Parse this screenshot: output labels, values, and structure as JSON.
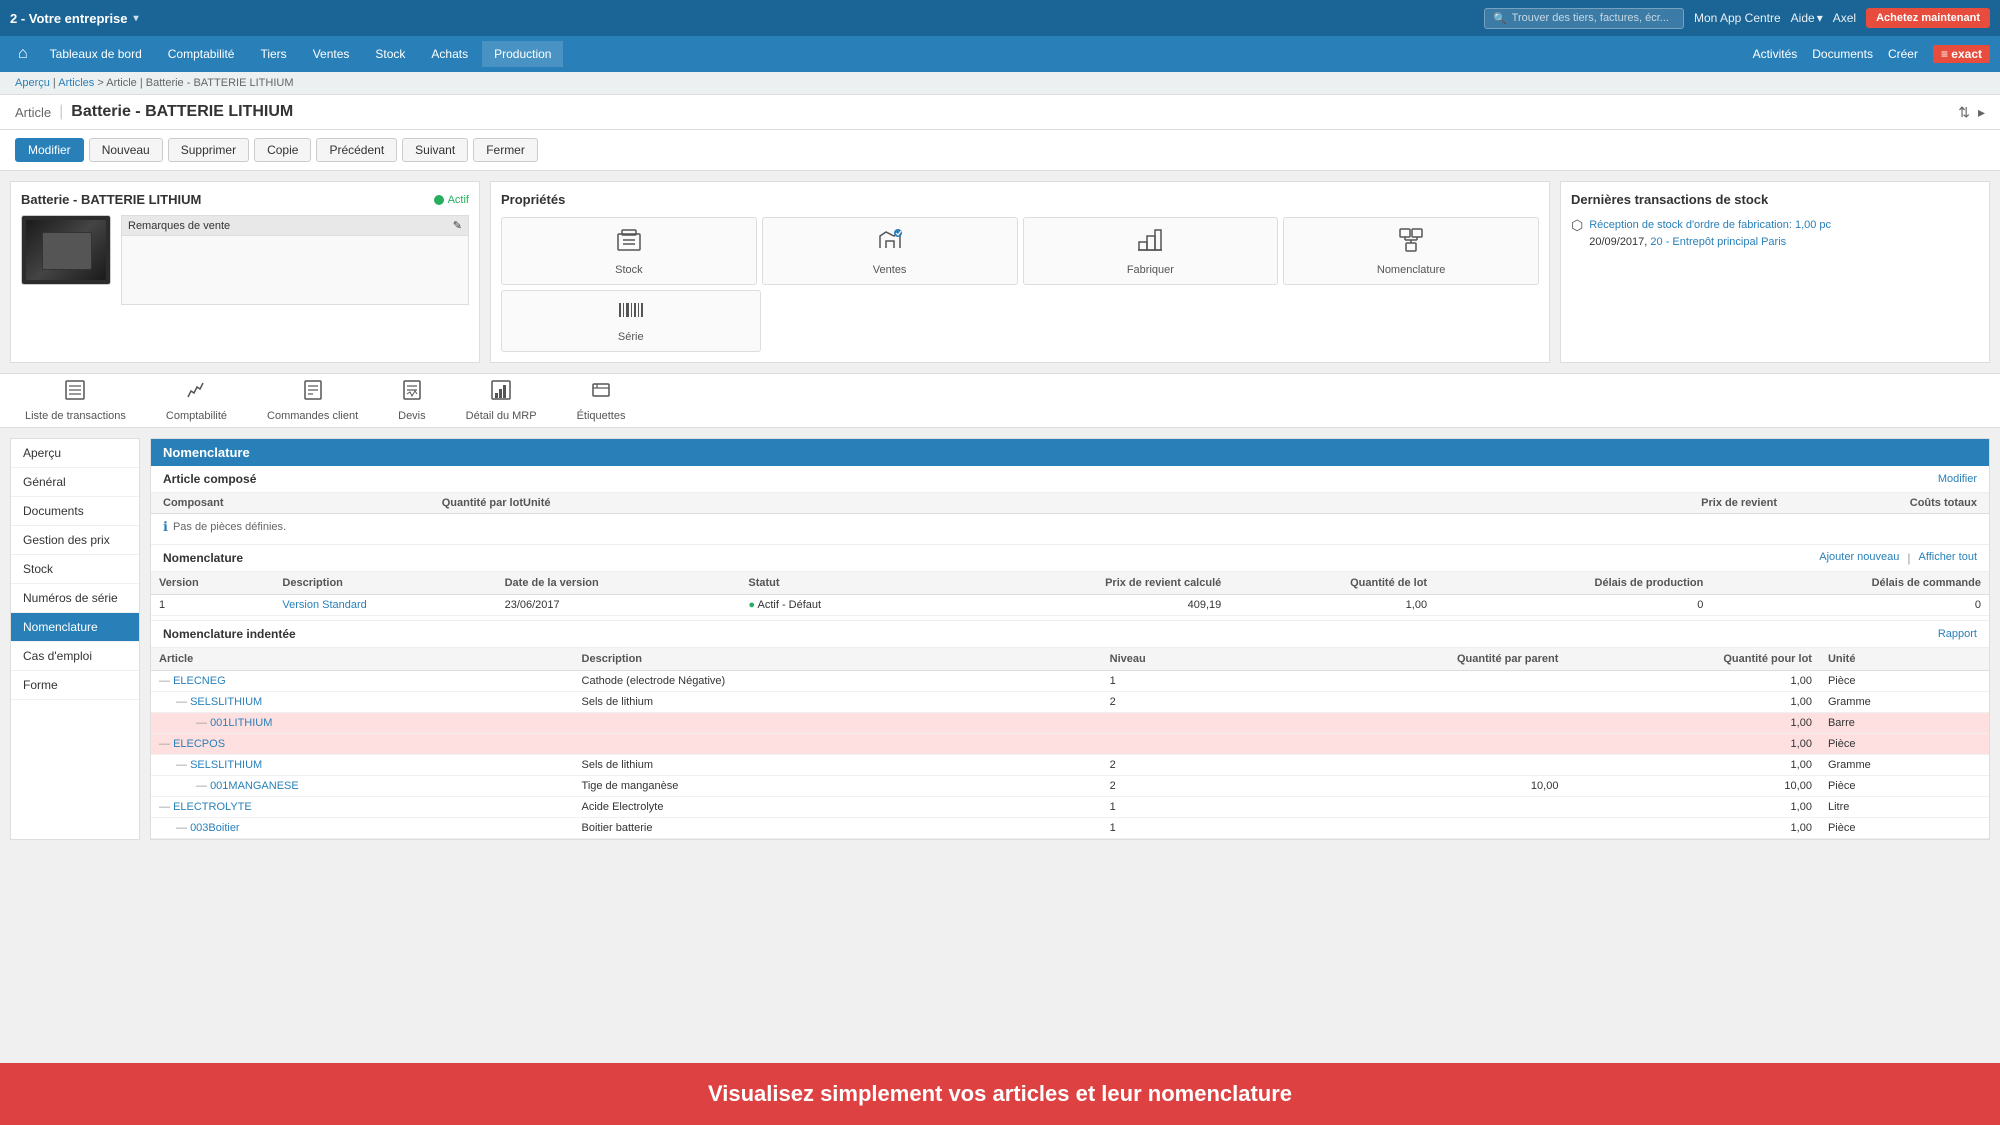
{
  "topbar": {
    "company": "2 - Votre entreprise",
    "search_placeholder": "Trouver des tiers, factures, écr...",
    "mon_app_centre": "Mon App Centre",
    "aide": "Aide",
    "user": "Axel",
    "achetez_label": "Achetez maintenant"
  },
  "navbar": {
    "home_icon": "⌂",
    "items": [
      "Tableaux de bord",
      "Comptabilité",
      "Tiers",
      "Ventes",
      "Stock",
      "Achats",
      "Production"
    ],
    "right_items": [
      "Activités",
      "Documents",
      "Créer"
    ],
    "exact_label": "≡ exact"
  },
  "breadcrumb": {
    "items": [
      "Aperçu",
      "Articles",
      "Article | Batterie - BATTERIE LITHIUM"
    ]
  },
  "page_header": {
    "label": "Article",
    "title": "Batterie - BATTERIE LITHIUM",
    "icon": "⇅"
  },
  "action_buttons": {
    "modifier": "Modifier",
    "nouveau": "Nouveau",
    "supprimer": "Supprimer",
    "copie": "Copie",
    "precedent": "Précédent",
    "suivant": "Suivant",
    "fermer": "Fermer"
  },
  "article": {
    "name": "Batterie - BATTERIE LITHIUM",
    "active_label": "Actif",
    "notes_label": "Remarques de vente",
    "edit_icon": "✎"
  },
  "proprietes": {
    "title": "Propriétés",
    "items": [
      {
        "icon": "📦",
        "label": "Stock"
      },
      {
        "icon": "🛒",
        "label": "Ventes"
      },
      {
        "icon": "🔧",
        "label": "Fabriquer"
      },
      {
        "icon": "📋",
        "label": "Nomenclature"
      },
      {
        "icon": "▦",
        "label": "Série"
      }
    ]
  },
  "transactions": {
    "title": "Dernières transactions de stock",
    "icon": "⬡",
    "text1": "Réception de stock d'ordre de fabrication:",
    "value1": "1,00 pc",
    "date1": "20/09/2017,",
    "link1": "20 - Entrepôt principal Paris"
  },
  "bottom_tabs": [
    {
      "icon": "☰",
      "label": "Liste de transactions"
    },
    {
      "icon": "∑",
      "label": "Comptabilité"
    },
    {
      "icon": "📋",
      "label": "Commandes client"
    },
    {
      "icon": "📄",
      "label": "Devis"
    },
    {
      "icon": "📊",
      "label": "Détail du MRP"
    },
    {
      "icon": "🏷",
      "label": "Étiquettes"
    }
  ],
  "sidebar": {
    "items": [
      {
        "label": "Aperçu",
        "active": false
      },
      {
        "label": "Général",
        "active": false
      },
      {
        "label": "Documents",
        "active": false
      },
      {
        "label": "Gestion des prix",
        "active": false
      },
      {
        "label": "Stock",
        "active": false
      },
      {
        "label": "Numéros de série",
        "active": false
      },
      {
        "label": "Nomenclature",
        "active": true
      },
      {
        "label": "Cas d'emploi",
        "active": false
      },
      {
        "label": "Forme",
        "active": false
      }
    ]
  },
  "nomenclature": {
    "section_title": "Nomenclature",
    "article_compose_title": "Article composé",
    "modifier_link": "Modifier",
    "table_headers": {
      "composant": "Composant",
      "qty": "Quantité par lot",
      "unite": "Unité",
      "prix": "Prix de revient",
      "cout": "Coûts totaux"
    },
    "no_pieces": "Pas de pièces définies.",
    "subsection2_title": "Nomenclature",
    "ajouter_link": "Ajouter nouveau",
    "afficher_link": "Afficher tout",
    "nom_headers": {
      "version": "Version",
      "description": "Description",
      "date": "Date de la version",
      "statut": "Statut",
      "prix_calcule": "Prix de revient calculé",
      "qty_lot": "Quantité de lot",
      "delais_prod": "Délais de production",
      "delais_cmd": "Délais de commande"
    },
    "nom_rows": [
      {
        "version": "1",
        "description": "Version Standard",
        "date": "23/06/2017",
        "statut_icon": "●",
        "statut": "Actif - Défaut",
        "prix": "409,19",
        "qty_lot": "1,00",
        "delais_prod": "0",
        "delais_cmd": "0"
      }
    ],
    "subsection3_title": "Nomenclature indentée",
    "rapport_link": "Rapport",
    "indent_headers": {
      "article": "Article",
      "description": "Description",
      "niveau": "Niveau",
      "qty_parent": "Quantité par parent",
      "qty_lot": "Quantité pour lot",
      "unite": "Unité"
    },
    "indent_rows": [
      {
        "indent": 0,
        "dash": "—",
        "code": "ELECNEG",
        "description": "Cathode (electrode Négative)",
        "niveau": "1",
        "qty_parent": "",
        "qty_lot": "1,00",
        "qty_lot2": "1,00",
        "unite": "Pièce",
        "highlight": ""
      },
      {
        "indent": 1,
        "dash": "—",
        "code": "SELSLITHIUM",
        "description": "Sels de lithium",
        "niveau": "2",
        "qty_parent": "",
        "qty_lot": "1,00",
        "qty_lot2": "1,00",
        "unite": "Gramme",
        "highlight": ""
      },
      {
        "indent": 2,
        "dash": "—",
        "code": "001LITHIUM",
        "description": "",
        "niveau": "",
        "qty_parent": "",
        "qty_lot": "1,00",
        "qty_lot2": "1,00",
        "unite": "Barre",
        "highlight": "red"
      },
      {
        "indent": 0,
        "dash": "—",
        "code": "ELECPOS",
        "description": "",
        "niveau": "",
        "qty_parent": "",
        "qty_lot": "1,00",
        "qty_lot2": "1,00",
        "unite": "Pièce",
        "highlight": "red"
      },
      {
        "indent": 1,
        "dash": "—",
        "code": "SELSLITHIUM",
        "description": "Sels de lithium",
        "niveau": "2",
        "qty_parent": "",
        "qty_lot": "1,00",
        "qty_lot2": "1,00",
        "unite": "Gramme",
        "highlight": ""
      },
      {
        "indent": 2,
        "dash": "—",
        "code": "001MANGANESE",
        "description": "Tige de manganèse",
        "niveau": "2",
        "qty_parent": "10,00",
        "qty_lot": "10,00",
        "qty_lot2": "10,00",
        "unite": "Pièce",
        "highlight": ""
      },
      {
        "indent": 0,
        "dash": "—",
        "code": "ELECTROLYTE",
        "description": "Acide Electrolyte",
        "niveau": "1",
        "qty_parent": "",
        "qty_lot": "1,00",
        "qty_lot2": "1,00",
        "unite": "Litre",
        "highlight": ""
      },
      {
        "indent": 1,
        "dash": "—",
        "code": "003Boitier",
        "description": "Boitier batterie",
        "niveau": "1",
        "qty_parent": "",
        "qty_lot": "1,00",
        "qty_lot2": "1,00",
        "unite": "Pièce",
        "highlight": ""
      }
    ]
  },
  "banner": {
    "text": "Visualisez simplement vos articles et leur nomenclature"
  }
}
